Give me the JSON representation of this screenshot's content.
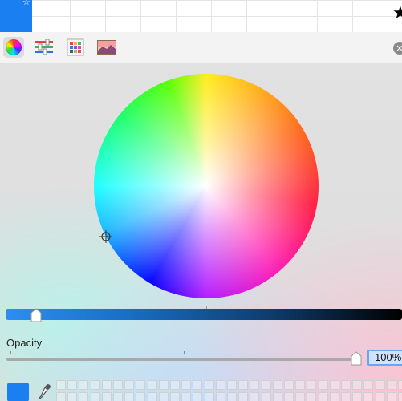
{
  "toolbar": {
    "items": [
      {
        "name": "color-wheel",
        "active": true
      },
      {
        "name": "color-sliders",
        "active": false
      },
      {
        "name": "color-palettes",
        "active": false
      },
      {
        "name": "image-palettes",
        "active": false
      }
    ]
  },
  "brightness": {
    "value_fraction": 0.08
  },
  "opacity": {
    "label": "Opacity",
    "value": "100%",
    "value_fraction": 1.0
  },
  "current_color": "#1a7ff0",
  "accent_color": "#1a7ff0"
}
